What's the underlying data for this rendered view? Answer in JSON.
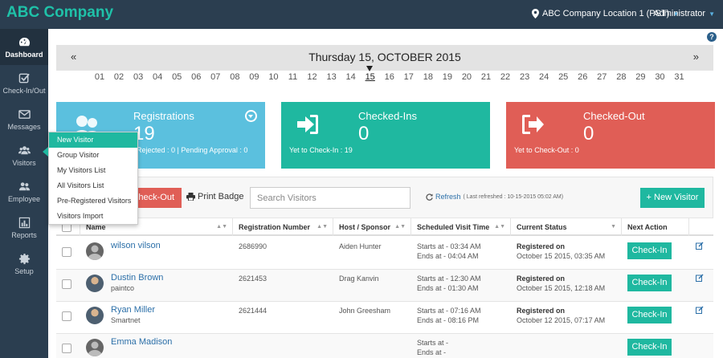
{
  "header": {
    "brand": "ABC Company",
    "location": "ABC Company Location 1 (PST)",
    "user": "Administrator"
  },
  "sidebar": {
    "items": [
      {
        "label": "Dashboard",
        "icon": "dashboard-icon"
      },
      {
        "label": "Check-In/Out",
        "icon": "checkbox-icon"
      },
      {
        "label": "Messages",
        "icon": "envelope-icon"
      },
      {
        "label": "Visitors",
        "icon": "users-icon"
      },
      {
        "label": "Employee",
        "icon": "employees-icon"
      },
      {
        "label": "Reports",
        "icon": "bar-chart-icon"
      },
      {
        "label": "Setup",
        "icon": "gear-icon"
      }
    ]
  },
  "visitors_menu": {
    "items": [
      "New Visitor",
      "Group Visitor",
      "My Visitors List",
      "All Visitors List",
      "Pre-Registered Visitors",
      "Visitors Import"
    ]
  },
  "date_nav": {
    "title": "Thursday 15, OCTOBER 2015",
    "prev": "«",
    "next": "»",
    "days": [
      "01",
      "02",
      "03",
      "04",
      "05",
      "06",
      "07",
      "08",
      "09",
      "10",
      "11",
      "12",
      "13",
      "14",
      "15",
      "16",
      "17",
      "18",
      "19",
      "20",
      "21",
      "22",
      "23",
      "24",
      "25",
      "26",
      "27",
      "28",
      "29",
      "30",
      "31"
    ],
    "selected": "15"
  },
  "cards": {
    "registrations": {
      "title": "Registrations",
      "value": "19",
      "sub": "Rejected : 0 | Pending Approval : 0"
    },
    "checked_ins": {
      "title": "Checked-Ins",
      "value": "0",
      "sub": "Yet to Check-In : 19"
    },
    "checked_out": {
      "title": "Checked-Out",
      "value": "0",
      "sub": "Yet to Check-Out : 0"
    }
  },
  "toolbar": {
    "checkout_label": "Check-Out",
    "print_label": "Print Badge",
    "search_placeholder": "Search Visitors",
    "refresh_label": "Refresh",
    "last_refreshed": "( Last refreshed : 10-15-2015 05:02 AM)",
    "new_visitor_label": "+ New Visitor"
  },
  "table": {
    "columns": [
      "Name",
      "Registration Number",
      "Host / Sponsor",
      "Scheduled Visit Time",
      "Current Status",
      "Next Action"
    ],
    "rows": [
      {
        "name": "wilson vilson",
        "company": "",
        "reg": "2686990",
        "host": "Aiden Hunter",
        "start": "Starts at - 03:34 AM",
        "end": "Ends at - 04:04 AM",
        "status": "Registered on",
        "status_date": "October 15 2015, 03:35 AM",
        "action": "Check-In",
        "photo": false
      },
      {
        "name": "Dustin Brown",
        "company": "paintco",
        "reg": "2621453",
        "host": "Drag Kanvin",
        "start": "Starts at - 12:30 AM",
        "end": "Ends at - 01:30 AM",
        "status": "Registered on",
        "status_date": "October 15 2015, 12:18 AM",
        "action": "Check-In",
        "photo": true
      },
      {
        "name": "Ryan Miller",
        "company": "Smartnet",
        "reg": "2621444",
        "host": "John Greesham",
        "start": "Starts at - 07:16 AM",
        "end": "Ends at - 08:16 PM",
        "status": "Registered on",
        "status_date": "October 12 2015, 07:17 AM",
        "action": "Check-In",
        "photo": true
      },
      {
        "name": "Emma Madison",
        "company": "",
        "reg": "",
        "host": "",
        "start": "Starts at -",
        "end": "Ends at -",
        "status": "",
        "status_date": "",
        "action": "Check-In",
        "photo": false
      }
    ]
  },
  "colors": {
    "sidebar": "#2b3e50",
    "brand": "#1fc1a8",
    "teal": "#1fb8a0",
    "blue": "#5bc0de",
    "red": "#e05e56"
  }
}
